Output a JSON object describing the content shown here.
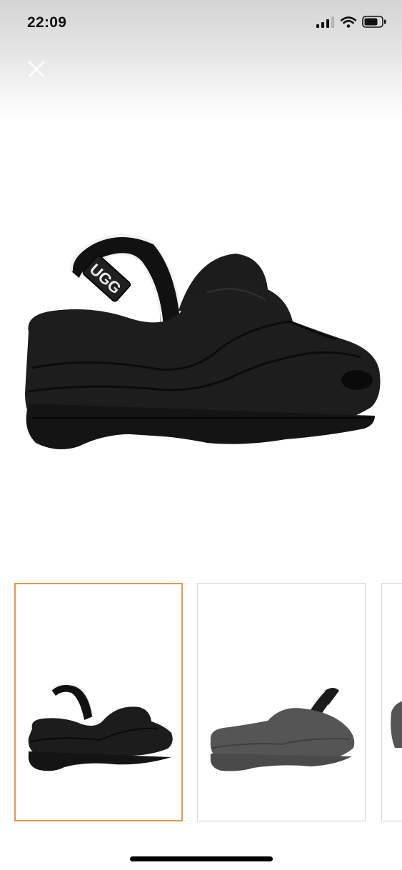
{
  "status_bar": {
    "time": "22:09",
    "icons": [
      "signal-icon",
      "wifi-icon",
      "battery-icon"
    ]
  },
  "toolbar": {
    "close_icon": "close-icon"
  },
  "gallery": {
    "main_logo_text": "UGG",
    "thumbnails": [
      {
        "variant": "black",
        "selected": true
      },
      {
        "variant": "grey",
        "selected": false
      },
      {
        "variant": "grey",
        "selected": false
      }
    ],
    "colors": {
      "selected_border": "#e39a4a",
      "thumb_border": "#d6d6d6",
      "shoe_black": "#1c1c1c",
      "shoe_grey": "#555555"
    }
  }
}
